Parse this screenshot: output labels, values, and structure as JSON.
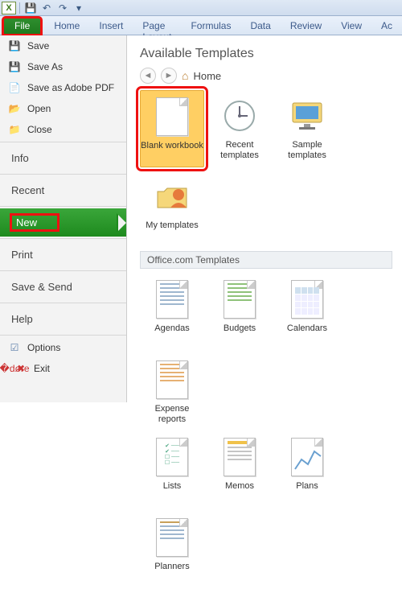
{
  "qat": {
    "app": "X"
  },
  "ribbon": {
    "file": "File",
    "tabs": [
      "Home",
      "Insert",
      "Page Layout",
      "Formulas",
      "Data",
      "Review",
      "View",
      "Ac"
    ]
  },
  "side": {
    "save": "Save",
    "save_as": "Save As",
    "save_pdf": "Save as Adobe PDF",
    "open": "Open",
    "close": "Close",
    "info": "Info",
    "recent": "Recent",
    "new": "New",
    "print": "Print",
    "save_send": "Save & Send",
    "help": "Help",
    "options": "Options",
    "exit": "Exit"
  },
  "content": {
    "title": "Available Templates",
    "home": "Home",
    "row1": [
      {
        "label": "Blank workbook"
      },
      {
        "label": "Recent templates"
      },
      {
        "label": "Sample templates"
      },
      {
        "label": "My templates"
      }
    ],
    "section": "Office.com Templates",
    "row2": [
      {
        "label": "Agendas"
      },
      {
        "label": "Budgets"
      },
      {
        "label": "Calendars"
      },
      {
        "label": "Expense reports"
      }
    ],
    "row3": [
      {
        "label": "Lists"
      },
      {
        "label": "Memos"
      },
      {
        "label": "Plans"
      },
      {
        "label": "Planners"
      }
    ]
  }
}
